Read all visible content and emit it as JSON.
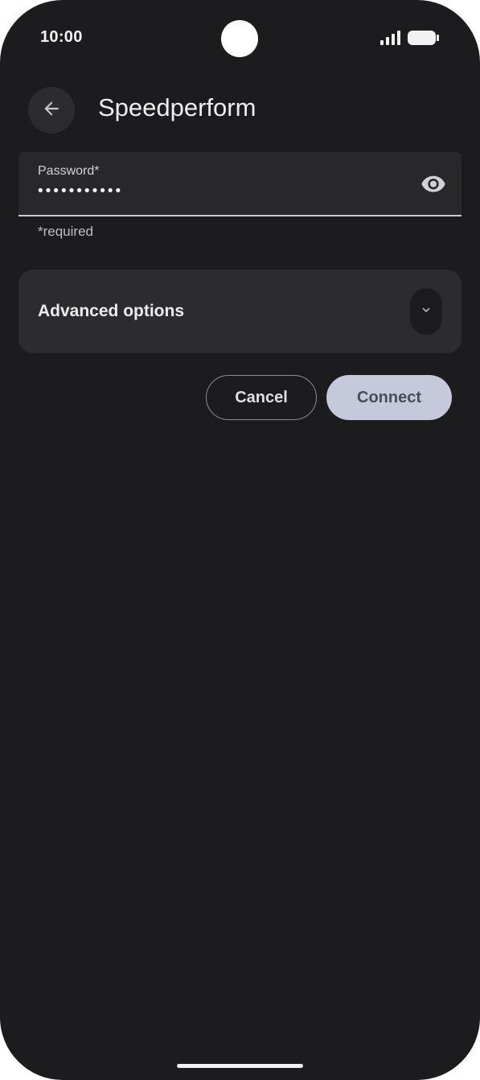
{
  "status_bar": {
    "time": "10:00",
    "icons": [
      "signal-icon",
      "battery-icon"
    ]
  },
  "app_bar": {
    "back_icon": "arrow-left-icon",
    "title": "Speedperform"
  },
  "password_field": {
    "label": "Password*",
    "value": "•••••••••••",
    "visibility_icon": "eye-icon",
    "helper_text": "*required"
  },
  "advanced": {
    "label": "Advanced options",
    "expand_icon": "chevron-down-icon",
    "expanded": false
  },
  "actions": {
    "cancel_label": "Cancel",
    "connect_label": "Connect"
  },
  "colors": {
    "background": "#1c1c1e",
    "surface": "#2c2c2e",
    "accent": "#c6c8dc"
  }
}
